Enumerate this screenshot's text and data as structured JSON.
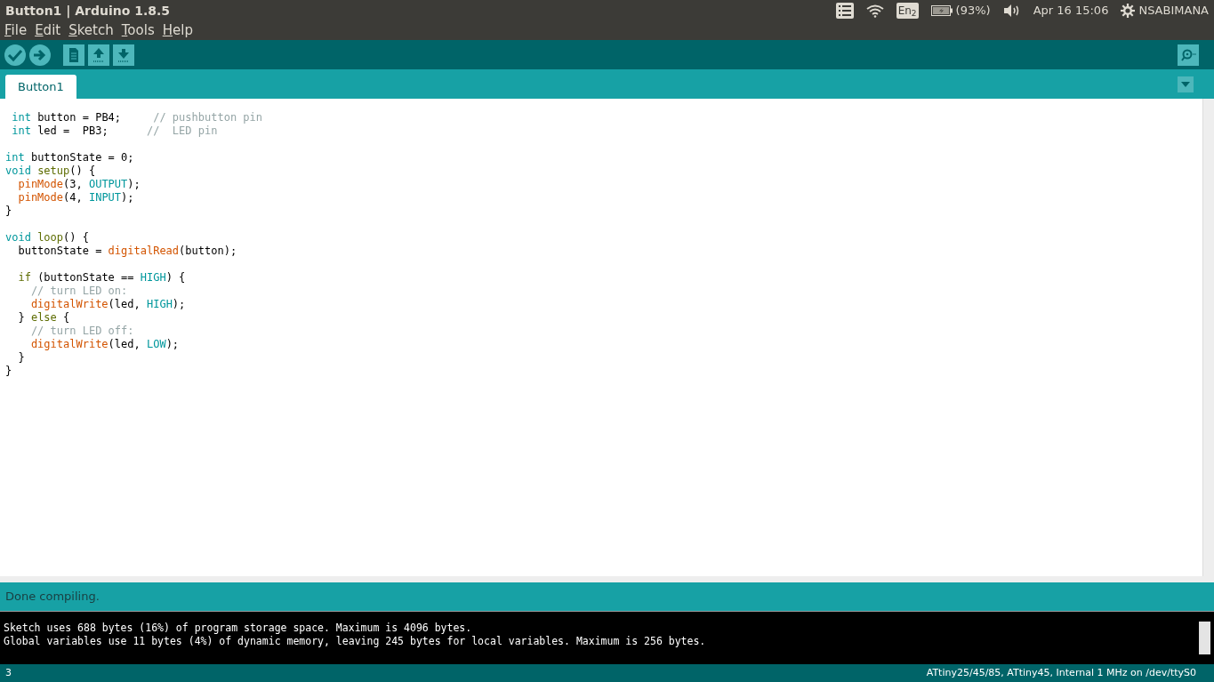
{
  "window": {
    "title": "Button1 | Arduino 1.8.5"
  },
  "tray": {
    "keyboard": "En$_{2}$",
    "battery": "(93%)",
    "clock": "Apr 16 15:06",
    "user": "NSABIMANA"
  },
  "menu": [
    "File",
    "Edit",
    "Sketch",
    "Tools",
    "Help"
  ],
  "toolbar": [
    {
      "kind": "verify"
    },
    {
      "kind": "upload"
    },
    {
      "kind": "new"
    },
    {
      "kind": "open"
    },
    {
      "kind": "save"
    }
  ],
  "tabs": [
    {
      "label": "Button1",
      "selected": true
    }
  ],
  "code": [
    {
      "kind": "code",
      "tokens": [
        {
          "kind": "type",
          "text": " int"
        },
        {
          "kind": "plain",
          "text": " button = PB4;     "
        },
        {
          "kind": "comment",
          "text": "// pushbutton pin"
        }
      ]
    },
    {
      "kind": "code",
      "tokens": [
        {
          "kind": "type",
          "text": " int"
        },
        {
          "kind": "plain",
          "text": " led =  PB3;      "
        },
        {
          "kind": "comment",
          "text": "//  LED pin"
        }
      ]
    },
    {
      "kind": "blank"
    },
    {
      "kind": "code",
      "tokens": [
        {
          "kind": "type",
          "text": "int"
        },
        {
          "kind": "plain",
          "text": " buttonState = 0;"
        }
      ]
    },
    {
      "kind": "code",
      "tokens": [
        {
          "kind": "type",
          "text": "void "
        },
        {
          "kind": "fn",
          "text": "setup"
        },
        {
          "kind": "plain",
          "text": "() {"
        }
      ]
    },
    {
      "kind": "code",
      "tokens": [
        {
          "kind": "builtin",
          "text": "  pinMode"
        },
        {
          "kind": "plain",
          "text": "(3, "
        },
        {
          "kind": "const",
          "text": "OUTPUT"
        },
        {
          "kind": "plain",
          "text": ");"
        }
      ]
    },
    {
      "kind": "code",
      "tokens": [
        {
          "kind": "builtin",
          "text": "  pinMode"
        },
        {
          "kind": "plain",
          "text": "(4, "
        },
        {
          "kind": "const",
          "text": "INPUT"
        },
        {
          "kind": "plain",
          "text": ");"
        }
      ]
    },
    {
      "kind": "code",
      "tokens": [
        {
          "kind": "plain",
          "text": "}"
        }
      ]
    },
    {
      "kind": "blank"
    },
    {
      "kind": "code",
      "tokens": [
        {
          "kind": "type",
          "text": "void "
        },
        {
          "kind": "fn",
          "text": "loop"
        },
        {
          "kind": "plain",
          "text": "() {"
        }
      ]
    },
    {
      "kind": "code",
      "tokens": [
        {
          "kind": "plain",
          "text": "  buttonState = "
        },
        {
          "kind": "builtin",
          "text": "digitalRead"
        },
        {
          "kind": "plain",
          "text": "(button);"
        }
      ]
    },
    {
      "kind": "blank"
    },
    {
      "kind": "code",
      "tokens": [
        {
          "kind": "fn",
          "text": "  if"
        },
        {
          "kind": "plain",
          "text": " (buttonState == "
        },
        {
          "kind": "const",
          "text": "HIGH"
        },
        {
          "kind": "plain",
          "text": ") {"
        }
      ]
    },
    {
      "kind": "code",
      "tokens": [
        {
          "kind": "comment",
          "text": "    // turn LED on:"
        }
      ]
    },
    {
      "kind": "code",
      "tokens": [
        {
          "kind": "builtin",
          "text": "    digitalWrite"
        },
        {
          "kind": "plain",
          "text": "(led, "
        },
        {
          "kind": "const",
          "text": "HIGH"
        },
        {
          "kind": "plain",
          "text": ");"
        }
      ]
    },
    {
      "kind": "code",
      "tokens": [
        {
          "kind": "plain",
          "text": "  } "
        },
        {
          "kind": "fn",
          "text": "else"
        },
        {
          "kind": "plain",
          "text": " {"
        }
      ]
    },
    {
      "kind": "code",
      "tokens": [
        {
          "kind": "comment",
          "text": "    // turn LED off:"
        }
      ]
    },
    {
      "kind": "code",
      "tokens": [
        {
          "kind": "builtin",
          "text": "    digitalWrite"
        },
        {
          "kind": "plain",
          "text": "(led, "
        },
        {
          "kind": "const",
          "text": "LOW"
        },
        {
          "kind": "plain",
          "text": ");"
        }
      ]
    },
    {
      "kind": "code",
      "tokens": [
        {
          "kind": "plain",
          "text": "  }"
        }
      ]
    },
    {
      "kind": "code",
      "tokens": [
        {
          "kind": "plain",
          "text": "}"
        }
      ]
    }
  ],
  "status": "Done compiling.",
  "console": [
    "Sketch uses 688 bytes (16%) of program storage space. Maximum is 4096 bytes.",
    "Global variables use 11 bytes (4%) of dynamic memory, leaving 245 bytes for local variables. Maximum is 256 bytes."
  ],
  "status_bar": {
    "line": "3",
    "board": "ATtiny25/45/85, ATtiny45, Internal 1 MHz on /dev/ttyS0"
  }
}
